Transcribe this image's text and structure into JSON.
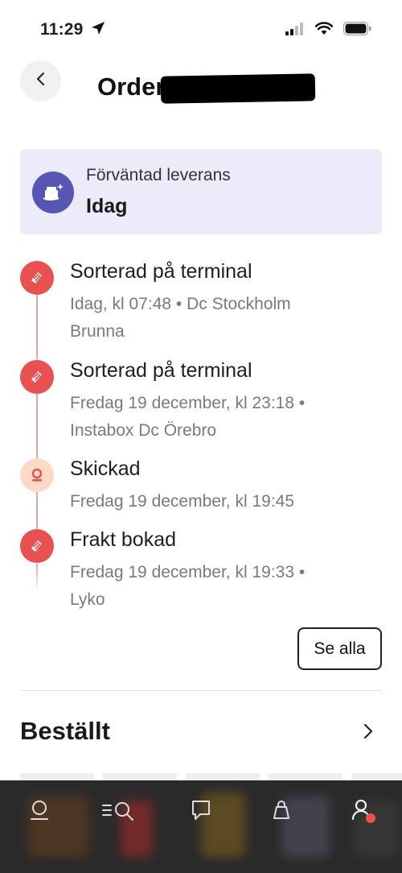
{
  "status_bar": {
    "time": "11:29"
  },
  "header": {
    "title": "Order"
  },
  "delivery": {
    "label": "Förväntad leverans",
    "value": "Idag"
  },
  "timeline": {
    "items": [
      {
        "title": "Sorterad på terminal",
        "subtitle": "Idag, kl 07:48 • Dc Stockholm Brunna",
        "icon": "parcel-stamp-icon"
      },
      {
        "title": "Sorterad på terminal",
        "subtitle": "Fredag 19 december, kl 23:18 • Instabox Dc Örebro",
        "icon": "parcel-stamp-icon"
      },
      {
        "title": "Skickad",
        "subtitle": "Fredag 19 december, kl 19:45",
        "icon": "sent-pin-icon"
      },
      {
        "title": "Frakt bokad",
        "subtitle": "Fredag 19 december, kl 19:33 • Lyko",
        "icon": "parcel-stamp-icon"
      }
    ],
    "see_all_label": "Se alla"
  },
  "ordered": {
    "title": "Beställt"
  },
  "colors": {
    "accent_red": "#e8514f",
    "accent_purple": "#5856b4",
    "card_bg": "#ecebfa",
    "tab_bar_bg": "#2b2a2a"
  }
}
